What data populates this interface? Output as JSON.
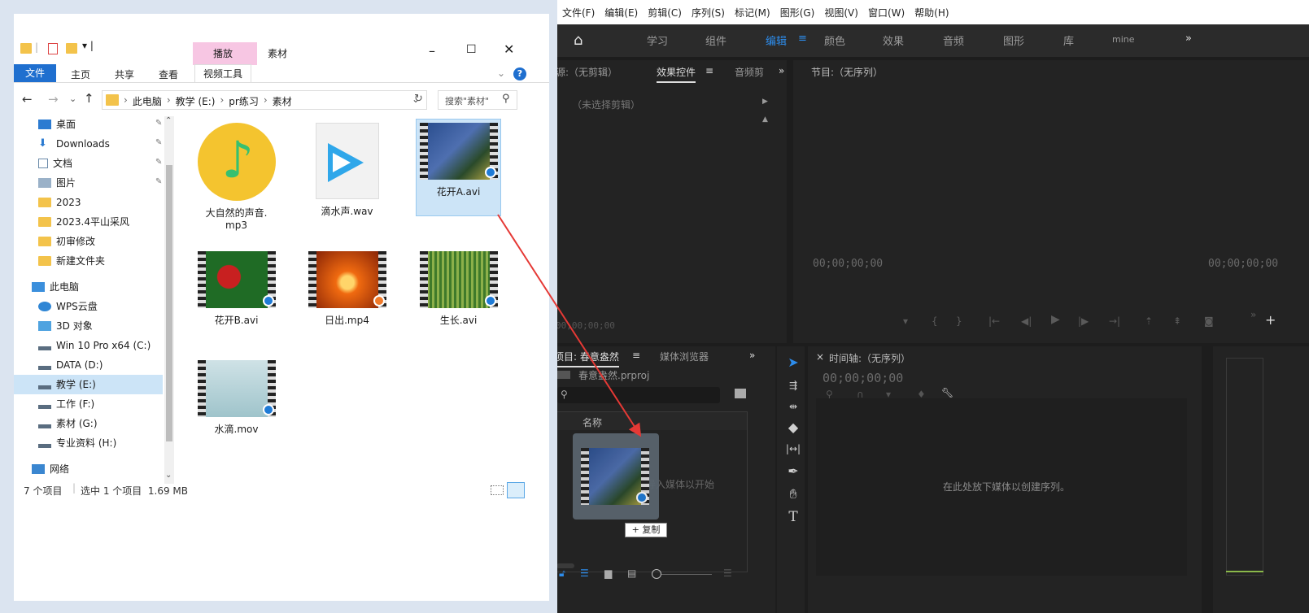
{
  "explorer": {
    "title": "素材",
    "context_tab": "播放",
    "ribbon": {
      "file": "文件",
      "home": "主页",
      "share": "共享",
      "view": "查看",
      "video_tools": "视频工具"
    },
    "breadcrumb": [
      "此电脑",
      "教学 (E:)",
      "pr练习",
      "素材"
    ],
    "search_placeholder": "搜索\"素材\"",
    "nav": [
      {
        "label": "桌面",
        "pinned": true,
        "icon": "desktop-icon"
      },
      {
        "label": "Downloads",
        "pinned": true,
        "icon": "download-icon"
      },
      {
        "label": "文档",
        "pinned": true,
        "icon": "document-icon"
      },
      {
        "label": "图片",
        "pinned": true,
        "icon": "picture-icon"
      },
      {
        "label": "2023",
        "icon": "folder-icon"
      },
      {
        "label": "2023.4平山采风",
        "icon": "folder-icon"
      },
      {
        "label": "初审修改",
        "icon": "folder-icon"
      },
      {
        "label": "新建文件夹",
        "icon": "folder-icon"
      },
      {
        "label": "此电脑",
        "icon": "computer-icon"
      },
      {
        "label": "WPS云盘",
        "icon": "cloud-icon"
      },
      {
        "label": "3D 对象",
        "icon": "cube-icon"
      },
      {
        "label": "Win 10 Pro x64 (C:)",
        "icon": "drive-icon"
      },
      {
        "label": "DATA (D:)",
        "icon": "drive-icon"
      },
      {
        "label": "教学 (E:)",
        "icon": "drive-icon",
        "selected": true
      },
      {
        "label": "工作 (F:)",
        "icon": "drive-icon"
      },
      {
        "label": "素材 (G:)",
        "icon": "drive-icon"
      },
      {
        "label": "专业资料 (H:)",
        "icon": "drive-icon"
      },
      {
        "label": "网络",
        "icon": "network-icon"
      }
    ],
    "files": [
      {
        "name": "大自然的声音.mp3",
        "line1": "大自然的声音.",
        "line2": "mp3",
        "icon": "music-note-icon"
      },
      {
        "name": "滴水声.wav",
        "line1": "滴水声.wav",
        "line2": "",
        "icon": "media-player-icon"
      },
      {
        "name": "花开A.avi",
        "line1": "花开A.avi",
        "line2": "",
        "icon": "video-thumb",
        "selected": true
      },
      {
        "name": "花开B.avi",
        "line1": "花开B.avi",
        "line2": "",
        "icon": "video-thumb"
      },
      {
        "name": "日出.mp4",
        "line1": "日出.mp4",
        "line2": "",
        "icon": "video-thumb"
      },
      {
        "name": "生长.avi",
        "line1": "生长.avi",
        "line2": "",
        "icon": "video-thumb"
      },
      {
        "name": "水滴.mov",
        "line1": "水滴.mov",
        "line2": "",
        "icon": "video-thumb"
      }
    ],
    "status": {
      "count": "7 个项目",
      "selected": "选中 1 个项目  1.69 MB"
    }
  },
  "premiere": {
    "menu": [
      "文件(F)",
      "编辑(E)",
      "剪辑(C)",
      "序列(S)",
      "标记(M)",
      "图形(G)",
      "视图(V)",
      "窗口(W)",
      "帮助(H)"
    ],
    "workspaces": [
      "学习",
      "组件",
      "编辑",
      "颜色",
      "效果",
      "音频",
      "图形",
      "库",
      "mine"
    ],
    "active_workspace": "编辑",
    "source_tab": "源:（无剪辑）",
    "effect_controls_tab": "效果控件",
    "audio_mixer_tab": "音频剪",
    "no_clip": "（未选择剪辑）",
    "program_tab": "节目:（无序列）",
    "timecode_zero": "00;00;00;00",
    "source_timecode": "00;00;00;00",
    "project_tab": "项目: 春意盎然",
    "media_browser_tab": "媒体浏览器",
    "project_file": "春意盎然.prproj",
    "name_column": "名称",
    "import_hint": "导入媒体以开始",
    "copy_badge": "+ 复制",
    "timeline_tab": "时间轴:（无序列）",
    "timeline_timecode": "00;00;00;00",
    "timeline_hint": "在此处放下媒体以创建序列。"
  },
  "colors": {
    "accent_blue": "#2d8ceb",
    "arrow_red": "#e53935",
    "folder_yellow": "#f3c34b"
  }
}
